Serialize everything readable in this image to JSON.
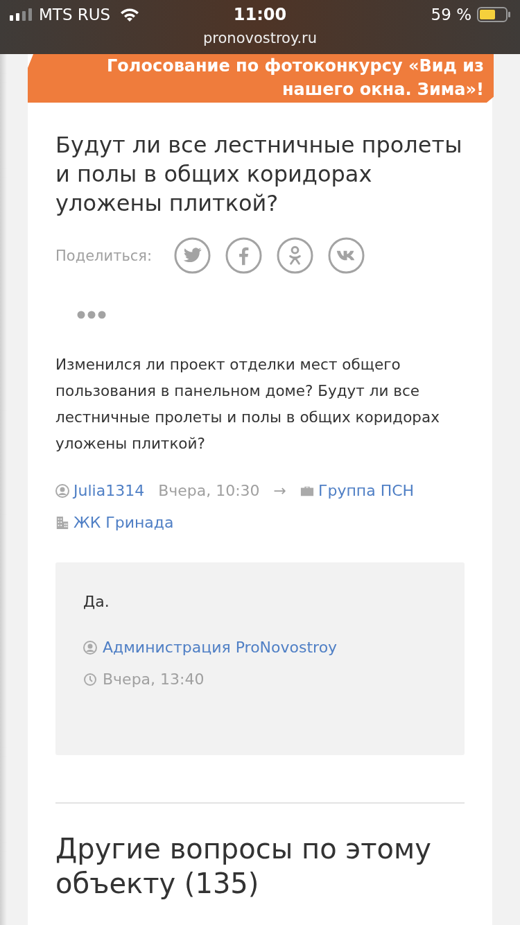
{
  "status_bar": {
    "carrier": "MTS RUS",
    "time": "11:00",
    "battery": "59 %",
    "url": "pronovostroy.ru"
  },
  "banner": {
    "text": "Голосование по фотоконкурсу «Вид из нашего окна. Зима»!"
  },
  "question": {
    "title": "Будут ли все лестничные пролеты и полы в общих коридорах уложены плиткой?",
    "share": {
      "label": "Поделиться:",
      "networks": [
        {
          "kind": "twitter"
        },
        {
          "kind": "facebook"
        },
        {
          "kind": "ok"
        },
        {
          "kind": "vk"
        }
      ]
    },
    "body": "Изменился ли проект отделки мест общего пользования в панельном доме? Будут ли все лестничные пролеты и полы в общих коридорах уложены плиткой?",
    "author": "Julia1314",
    "time": "Вчера, 10:30",
    "arrow": "→",
    "company": "Группа ПСН",
    "complex": "ЖК Гринада"
  },
  "answer": {
    "text": "Да.",
    "author": "Администрация ProNovostroy",
    "time": "Вчера, 13:40"
  },
  "other_questions": {
    "title": "Другие вопросы по этому объекту (135)"
  }
}
